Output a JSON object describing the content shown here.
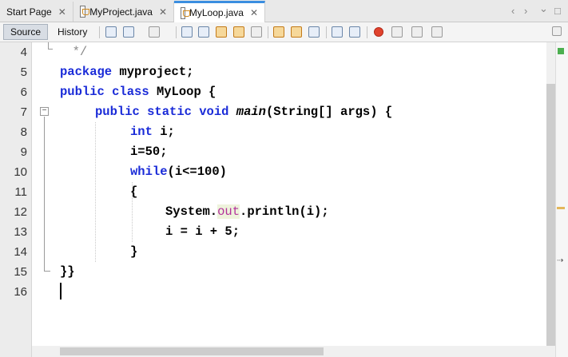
{
  "tabs": [
    {
      "label": "Start Page",
      "active": false
    },
    {
      "label": "MyProject.java",
      "active": false
    },
    {
      "label": "MyLoop.java",
      "active": true
    }
  ],
  "tab_controls": {
    "prev": "‹",
    "next": "›",
    "dropdown": "⌄",
    "restore": "□"
  },
  "toolbar": {
    "source_label": "Source",
    "history_label": "History"
  },
  "editor": {
    "line_numbers": [
      "4",
      "5",
      "6",
      "7",
      "8",
      "9",
      "10",
      "11",
      "12",
      "13",
      "14",
      "15",
      "16"
    ],
    "lines": {
      "l4": "*/",
      "l5_kw": "package",
      "l5_rest": " myproject;",
      "l6_kw1": "public",
      "l6_kw2": "class",
      "l6_rest": " MyLoop {",
      "l7_kw1": "public",
      "l7_kw2": "static",
      "l7_kw3": "void",
      "l7_method": "main",
      "l7_rest": "(String[] args) {",
      "l8_kw": "int",
      "l8_rest": " i;",
      "l9": "i=50;",
      "l10_kw": "while",
      "l10_rest": "(i<=100)",
      "l11": "{",
      "l12_a": "System.",
      "l12_field": "out",
      "l12_b": ".println(i);",
      "l13": "i = i + 5;",
      "l14": "}",
      "l15": "}}"
    }
  },
  "colors": {
    "keyword": "#1a2bd8",
    "field": "#b3309a",
    "current_line": "#fbf7e6",
    "tab_accent": "#3b8ee0"
  }
}
